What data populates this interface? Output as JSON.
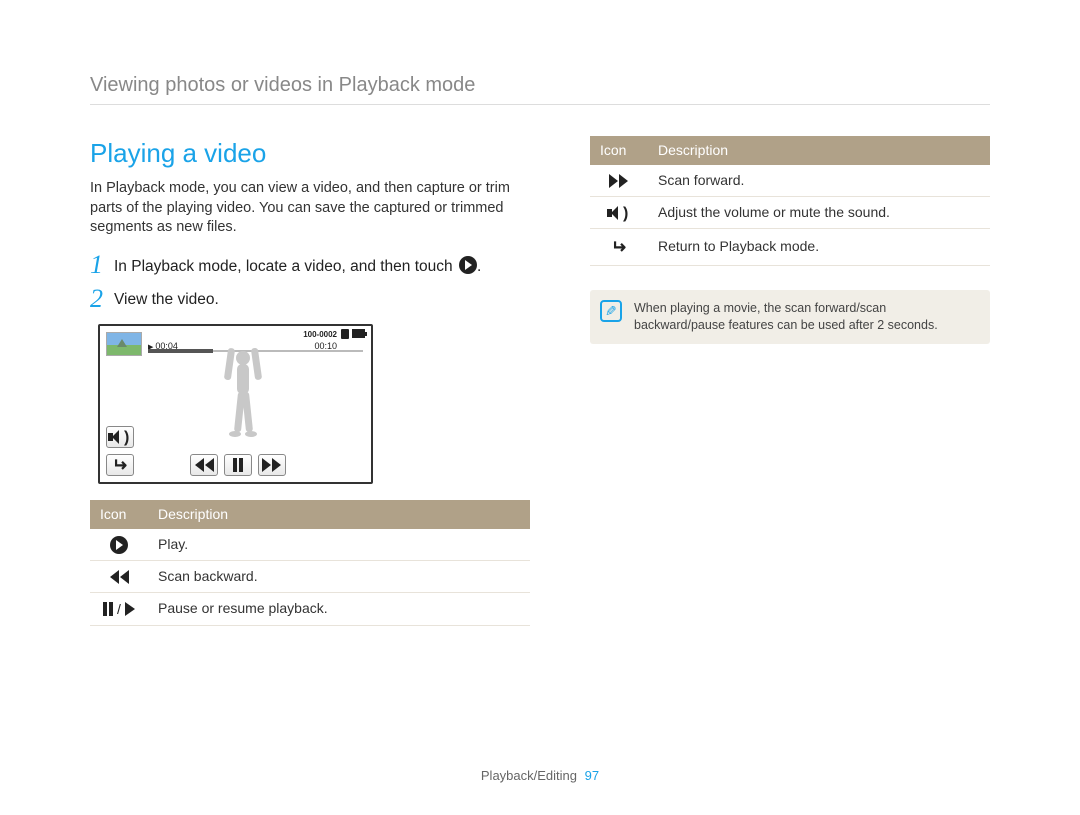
{
  "header": "Viewing photos or videos in Playback mode",
  "section_title": "Playing a video",
  "intro": "In Playback mode, you can view a video, and then capture or trim parts of the playing video. You can save the captured or trimmed segments as new files.",
  "steps": [
    {
      "num": "1",
      "text_prefix": "In Playback mode, locate a video, and then touch ",
      "text_suffix": "."
    },
    {
      "num": "2",
      "text": "View the video."
    }
  ],
  "video_mock": {
    "time_left": "00:04",
    "time_right": "00:10",
    "file_no": "100-0002"
  },
  "table_headers": {
    "icon": "Icon",
    "desc": "Description"
  },
  "table_left": [
    {
      "icon": "play",
      "desc": "Play."
    },
    {
      "icon": "rew",
      "desc": "Scan backward."
    },
    {
      "icon": "pauseplay",
      "desc": "Pause or resume playback."
    }
  ],
  "table_right": [
    {
      "icon": "ff",
      "desc": "Scan forward."
    },
    {
      "icon": "vol",
      "desc": "Adjust the volume or mute the sound."
    },
    {
      "icon": "return",
      "desc": "Return to Playback mode."
    }
  ],
  "note": "When playing a movie, the scan forward/scan backward/pause features can be used after 2 seconds.",
  "footer": {
    "section": "Playback/Editing",
    "page": "97"
  }
}
